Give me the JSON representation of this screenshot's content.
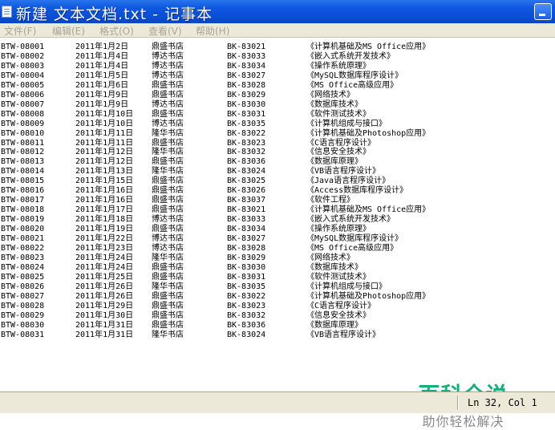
{
  "window": {
    "title": "新建 文本文档.txt - 记事本"
  },
  "menu": [
    {
      "label": "文件(F)"
    },
    {
      "label": "编辑(E)"
    },
    {
      "label": "格式(O)"
    },
    {
      "label": "查看(V)"
    },
    {
      "label": "帮助(H)"
    }
  ],
  "rows": [
    [
      "BTW-08001",
      "2011年1月2日",
      "鼎盛书店",
      "BK-83021",
      "《计算机基础及MS Office应用》"
    ],
    [
      "BTW-08002",
      "2011年1月4日",
      "博达书店",
      "BK-83033",
      "《嵌入式系统开发技术》"
    ],
    [
      "BTW-08003",
      "2011年1月4日",
      "博达书店",
      "BK-83034",
      "《操作系统原理》"
    ],
    [
      "BTW-08004",
      "2011年1月5日",
      "博达书店",
      "BK-83027",
      "《MySQL数据库程序设计》"
    ],
    [
      "BTW-08005",
      "2011年1月6日",
      "鼎盛书店",
      "BK-83028",
      "《MS Office高级应用》"
    ],
    [
      "BTW-08006",
      "2011年1月9日",
      "鼎盛书店",
      "BK-83029",
      "《网络技术》"
    ],
    [
      "BTW-08007",
      "2011年1月9日",
      "博达书店",
      "BK-83030",
      "《数据库技术》"
    ],
    [
      "BTW-08008",
      "2011年1月10日",
      "鼎盛书店",
      "BK-83031",
      "《软件测试技术》"
    ],
    [
      "BTW-08009",
      "2011年1月10日",
      "博达书店",
      "BK-83035",
      "《计算机组成与接口》"
    ],
    [
      "BTW-08010",
      "2011年1月11日",
      "隆华书店",
      "BK-83022",
      "《计算机基础及Photoshop应用》"
    ],
    [
      "BTW-08011",
      "2011年1月11日",
      "鼎盛书店",
      "BK-83023",
      "《C语言程序设计》"
    ],
    [
      "BTW-08012",
      "2011年1月12日",
      "隆华书店",
      "BK-83032",
      "《信息安全技术》"
    ],
    [
      "BTW-08013",
      "2011年1月12日",
      "鼎盛书店",
      "BK-83036",
      "《数据库原理》"
    ],
    [
      "BTW-08014",
      "2011年1月13日",
      "隆华书店",
      "BK-83024",
      "《VB语言程序设计》"
    ],
    [
      "BTW-08015",
      "2011年1月15日",
      "鼎盛书店",
      "BK-83025",
      "《Java语言程序设计》"
    ],
    [
      "BTW-08016",
      "2011年1月16日",
      "鼎盛书店",
      "BK-83026",
      "《Access数据库程序设计》"
    ],
    [
      "BTW-08017",
      "2011年1月16日",
      "鼎盛书店",
      "BK-83037",
      "《软件工程》"
    ],
    [
      "BTW-08018",
      "2011年1月17日",
      "鼎盛书店",
      "BK-83021",
      "《计算机基础及MS Office应用》"
    ],
    [
      "BTW-08019",
      "2011年1月18日",
      "博达书店",
      "BK-83033",
      "《嵌入式系统开发技术》"
    ],
    [
      "BTW-08020",
      "2011年1月19日",
      "鼎盛书店",
      "BK-83034",
      "《操作系统原理》"
    ],
    [
      "BTW-08021",
      "2011年1月22日",
      "博达书店",
      "BK-83027",
      "《MySQL数据库程序设计》"
    ],
    [
      "BTW-08022",
      "2011年1月23日",
      "博达书店",
      "BK-83028",
      "《MS Office高级应用》"
    ],
    [
      "BTW-08023",
      "2011年1月24日",
      "隆华书店",
      "BK-83029",
      "《网络技术》"
    ],
    [
      "BTW-08024",
      "2011年1月24日",
      "鼎盛书店",
      "BK-83030",
      "《数据库技术》"
    ],
    [
      "BTW-08025",
      "2011年1月25日",
      "鼎盛书店",
      "BK-83031",
      "《软件测试技术》"
    ],
    [
      "BTW-08026",
      "2011年1月26日",
      "隆华书店",
      "BK-83035",
      "《计算机组成与接口》"
    ],
    [
      "BTW-08027",
      "2011年1月26日",
      "鼎盛书店",
      "BK-83022",
      "《计算机基础及Photoshop应用》"
    ],
    [
      "BTW-08028",
      "2011年1月29日",
      "鼎盛书店",
      "BK-83023",
      "《C语言程序设计》"
    ],
    [
      "BTW-08029",
      "2011年1月30日",
      "鼎盛书店",
      "BK-83032",
      "《信息安全技术》"
    ],
    [
      "BTW-08030",
      "2011年1月31日",
      "鼎盛书店",
      "BK-83036",
      "《数据库原理》"
    ],
    [
      "BTW-08031",
      "2011年1月31日",
      "隆华书店",
      "BK-83024",
      "《VB语言程序设计》"
    ]
  ],
  "watermark": {
    "main": "百科全说",
    "sub": "助你轻松解决"
  },
  "status": {
    "position": "Ln 32, Col 1"
  }
}
